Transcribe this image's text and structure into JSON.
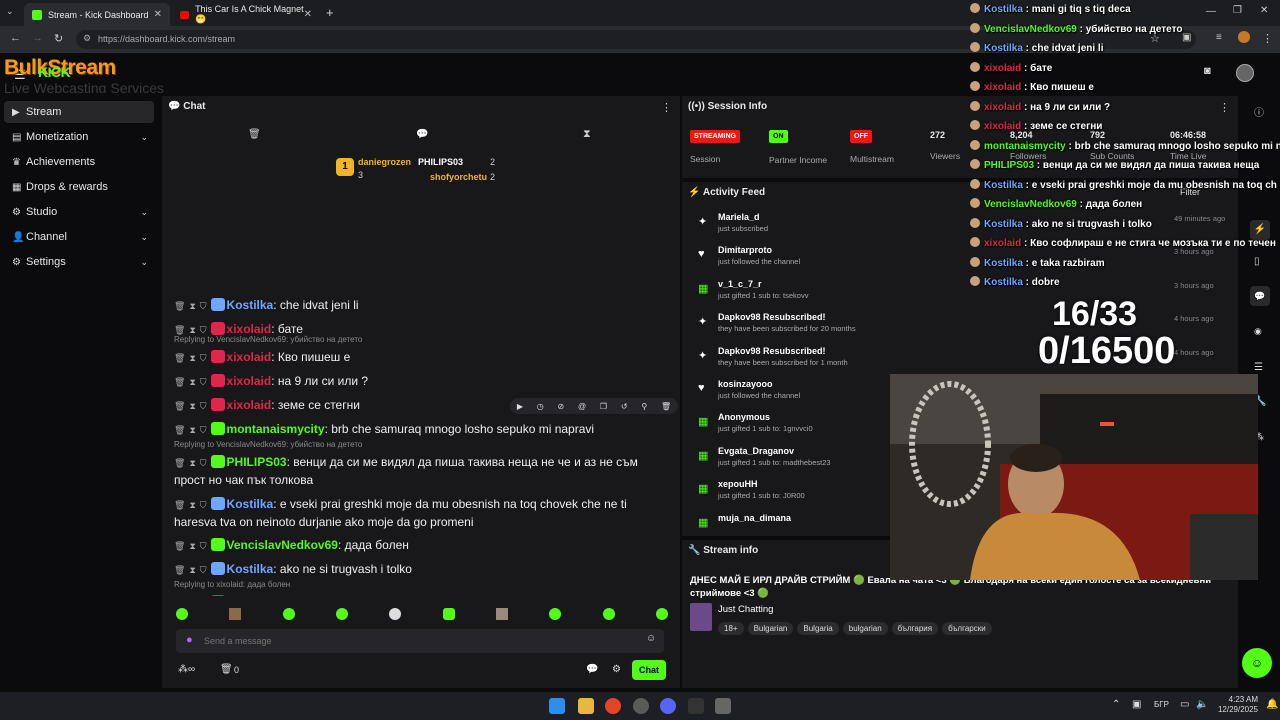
{
  "browser": {
    "tabs": [
      {
        "title": "Stream - Kick Dashboard",
        "active": true
      },
      {
        "title": "This Car Is A Chick Magnet😁",
        "active": false
      }
    ],
    "url": "https://dashboard.kick.com/stream"
  },
  "logo": {
    "text": "BulkStream",
    "sub": "Live Webcasting Services",
    "kick": "KICK"
  },
  "sidebar": {
    "items": [
      {
        "label": "Stream",
        "icon": "video-icon",
        "expand": false
      },
      {
        "label": "Monetization",
        "icon": "money-icon",
        "expand": true
      },
      {
        "label": "Achievements",
        "icon": "trophy-icon",
        "expand": false
      },
      {
        "label": "Drops & rewards",
        "icon": "gift-icon",
        "expand": false
      },
      {
        "label": "Studio",
        "icon": "gear-icon",
        "expand": true
      },
      {
        "label": "Channel",
        "icon": "person-icon",
        "expand": true
      },
      {
        "label": "Settings",
        "icon": "settings-icon",
        "expand": true
      }
    ]
  },
  "chat": {
    "title": "Chat",
    "top": [
      {
        "name": "daniegrozen",
        "count": "3",
        "rank": "1"
      },
      {
        "name": "PHILIPS03",
        "count": "2"
      },
      {
        "name": "shofyorchetu",
        "count": "2"
      }
    ],
    "messages": [
      {
        "reply": "",
        "user": "Kostilka",
        "color": "#6fa6ff",
        "text": "che idvat jeni li"
      },
      {
        "reply": "",
        "user": "xixolaid",
        "color": "#e0264a",
        "text": "бате"
      },
      {
        "reply": "Replying to VencislavNedkov69: убийство на детето",
        "user": "xixolaid",
        "color": "#e0264a",
        "text": "Кво пишеш е"
      },
      {
        "reply": "",
        "user": "xixolaid",
        "color": "#e0264a",
        "text": "на 9 ли си или ?"
      },
      {
        "reply": "",
        "user": "xixolaid",
        "color": "#e0264a",
        "text": "земе се стегни"
      },
      {
        "reply": "",
        "user": "montanaismycity",
        "color": "#53fc18",
        "text": "brb che samuraq mnogo losho sepuko mi napravi"
      },
      {
        "reply": "Replying to VencislavNedkov69: убийство на детето",
        "user": "PHILIPS03",
        "color": "#53fc18",
        "text": "венци да си ме видял да пиша такива неща не че и аз не съм прост но чак пък толкова"
      },
      {
        "reply": "",
        "user": "Kostilka",
        "color": "#6fa6ff",
        "text": "e vseki prai greshki moje da mu obesnish na toq chovek che ne ti haresva tva on neinoto durjanie ako moje da go promeni"
      },
      {
        "reply": "",
        "user": "VencislavNedkov69",
        "color": "#53fc18",
        "text": "дада болен"
      },
      {
        "reply": "",
        "user": "Kostilka",
        "color": "#6fa6ff",
        "text": "ako ne si trugvash i tolko"
      },
      {
        "reply": "Replying to xixolaid: дада болен",
        "user": "xixolaid",
        "color": "#e0264a",
        "text": "Кво софлираш е не стига че мозъка ти е по течен от сперма че си мислиш ще моеш да отговаряш"
      },
      {
        "reply": "",
        "user": "Kostilka",
        "color": "#6fa6ff",
        "text": "e taka razbiram"
      },
      {
        "reply": "",
        "user": "Kostilka",
        "color": "#6fa6ff",
        "text": "dobre"
      }
    ],
    "input_placeholder": "Send a message",
    "send_label": "Chat",
    "footer_count": "0"
  },
  "session": {
    "title": "Session Info",
    "stats": [
      {
        "badge": "STREAMING",
        "badge_color": "#e91916",
        "label": "Session"
      },
      {
        "badge": "ON",
        "badge_color": "#53fc18",
        "label": "Partner Income"
      },
      {
        "badge": "OFF",
        "badge_color": "#e91916",
        "label": "Multistream"
      },
      {
        "value": "272",
        "label": "Viewers"
      },
      {
        "value": "8,204",
        "label": "Followers"
      },
      {
        "value": "792",
        "label": "Sub Counts"
      },
      {
        "value": "06:46:58",
        "label": "Time Live"
      }
    ]
  },
  "activity": {
    "title": "Activity Feed",
    "filter": "Filter",
    "items": [
      {
        "name": "Mariela_d",
        "sub": "just subscribed",
        "time": "49 minutes ago",
        "icon": "star-icon"
      },
      {
        "name": "Dimitarproto",
        "sub": "just followed the channel",
        "time": "3 hours ago",
        "icon": "heart-icon"
      },
      {
        "name": "v_1_c_7_r",
        "sub": "just gifted 1 sub to: tsekovv",
        "time": "3 hours ago",
        "icon": "gift-icon"
      },
      {
        "name": "Dapkov98 Resubscribed!",
        "sub": "they have been subscribed for 20 months",
        "time": "4 hours ago",
        "icon": "star-icon"
      },
      {
        "name": "Dapkov98 Resubscribed!",
        "sub": "they have been subscribed for 1 month",
        "time": "4 hours ago",
        "icon": "star-icon"
      },
      {
        "name": "kosinzayooo",
        "sub": "just followed the channel",
        "time": "",
        "icon": "heart-icon"
      },
      {
        "name": "Anonymous",
        "sub": "just gifted 1 sub to: 1gnvvci0",
        "time": "",
        "icon": "gift-icon"
      },
      {
        "name": "Evgata_Draganov",
        "sub": "just gifted 1 sub to: madthebest23",
        "time": "",
        "icon": "gift-icon"
      },
      {
        "name": "xepouHH",
        "sub": "just gifted 1 sub to: J0R00",
        "time": "",
        "icon": "gift-icon"
      },
      {
        "name": "muja_na_dimana",
        "sub": "",
        "time": "",
        "icon": "gift-icon"
      }
    ]
  },
  "stream_info": {
    "title": "Stream info",
    "stream_title": "ДНЕС МАЙ Е ИРЛ ДРАЙВ СТРИЙМ 🟢 Евала на чата <3 🟢 Благодаря на всеки един голосте са за всекидневни стриймове <3 🟢",
    "category": "Just Chatting",
    "tags": [
      "18+",
      "Bulgarian",
      "Bulgaria",
      "bulgarian",
      "българия",
      "български"
    ]
  },
  "overlay": {
    "messages": [
      {
        "user": "Kostilka",
        "color": "#6fa6ff",
        "text": "mani gi tiq s tiq deca"
      },
      {
        "user": "VencislavNedkov69",
        "color": "#53fc18",
        "text": "убийство на детето"
      },
      {
        "user": "Kostilka",
        "color": "#6fa6ff",
        "text": "che idvat jeni li"
      },
      {
        "user": "xixolaid",
        "color": "#e0264a",
        "text": "бате"
      },
      {
        "user": "xixolaid",
        "color": "#e0264a",
        "text": "Кво пишеш е"
      },
      {
        "user": "xixolaid",
        "color": "#e0264a",
        "text": "на 9 ли си или ?"
      },
      {
        "user": "xixolaid",
        "color": "#e0264a",
        "text": "земе се стегни"
      },
      {
        "user": "montanaismycity",
        "color": "#53fc18",
        "text": "brb che samuraq mnogo losho sepuko mi napravi"
      },
      {
        "user": "PHILIPS03",
        "color": "#53fc18",
        "text": "венци да си ме видял да пиша такива неща"
      },
      {
        "user": "Kostilka",
        "color": "#6fa6ff",
        "text": "e vseki prai greshki moje da mu obesnish na toq ch"
      },
      {
        "user": "VencislavNedkov69",
        "color": "#53fc18",
        "text": "дада болен"
      },
      {
        "user": "Kostilka",
        "color": "#6fa6ff",
        "text": "ako ne si trugvash i tolko"
      },
      {
        "user": "xixolaid",
        "color": "#e0264a",
        "text": "Кво софлираш е не стига че мозъка ти е по течен"
      },
      {
        "user": "Kostilka",
        "color": "#6fa6ff",
        "text": "e taka razbiram"
      },
      {
        "user": "Kostilka",
        "color": "#6fa6ff",
        "text": "dobre"
      }
    ],
    "goal1": "16/33",
    "goal2": "0/16500"
  },
  "taskbar": {
    "lang": "БГР",
    "time": "4:23 AM",
    "date": "12/29/2025"
  }
}
